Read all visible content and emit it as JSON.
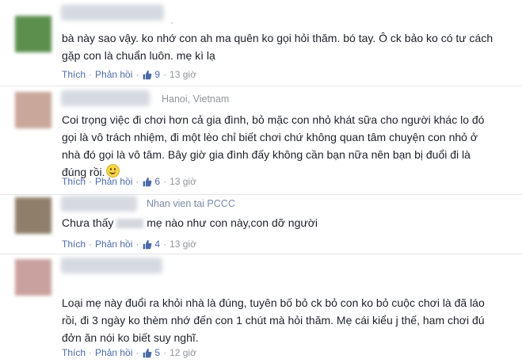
{
  "comments": [
    {
      "meta": "",
      "text": "bà này sao vậy. ko nhớ con ah ma quên ko gọi hỏi thăm. bó tay. Ô ck bảo ko có tư cách\ngặp con là chuẩn luôn. mẹ kì lạ",
      "like_label": "Thích",
      "reply_label": "Phản hồi",
      "likes": "9",
      "time": "13 giờ",
      "avatar_color": "#5c8f4e"
    },
    {
      "meta": "Hanoi, Vietnam",
      "text": "Coi trọng việc đi chơi hơn cả gia đình, bỏ mặc con nhỏ khát sữa cho người khác lo đó\ngọi là vô trách nhiệm, đi một lèo chỉ biết chơi chứ không quan tâm chuyện con nhỏ ở\nnhà đó gọi là vô tâm. Bây giờ gia đình đấy không cần bạn nữa nên bạn bị đuổi đi là\nđúng rồi.",
      "like_label": "Thích",
      "reply_label": "Phản hồi",
      "likes": "6",
      "time": "13 giờ",
      "avatar_color": "#c9a79a"
    },
    {
      "meta": "Nhan vien tai PCCC",
      "text_before": "Chưa thấy",
      "text_after": "mẹ nào như con này,con dỡ người",
      "like_label": "Thích",
      "reply_label": "Phản hồi",
      "likes": "4",
      "time": "13 giờ",
      "avatar_color": "#8f7f6a"
    },
    {
      "meta": "",
      "text": "Loại mẹ này đuổi ra khỏi nhà là đúng, tuyên bố bỏ ck bỏ con ko bỏ cuộc chơi là đã láo\nrồi, đi 3 ngày ko thèm nhớ đến con 1 chút mà hỏi thăm. Mẹ cái kiểu j thế, ham chơi đú\nđởn ăn nói ko biết suy nghĩ.",
      "like_label": "Thích",
      "reply_label": "Phản hồi",
      "likes": "5",
      "time": "12 giờ",
      "avatar_color": "#c9a29f"
    }
  ],
  "colors": {
    "link": "#4b6aa7",
    "meta": "#90949c",
    "text": "#1d2129"
  }
}
